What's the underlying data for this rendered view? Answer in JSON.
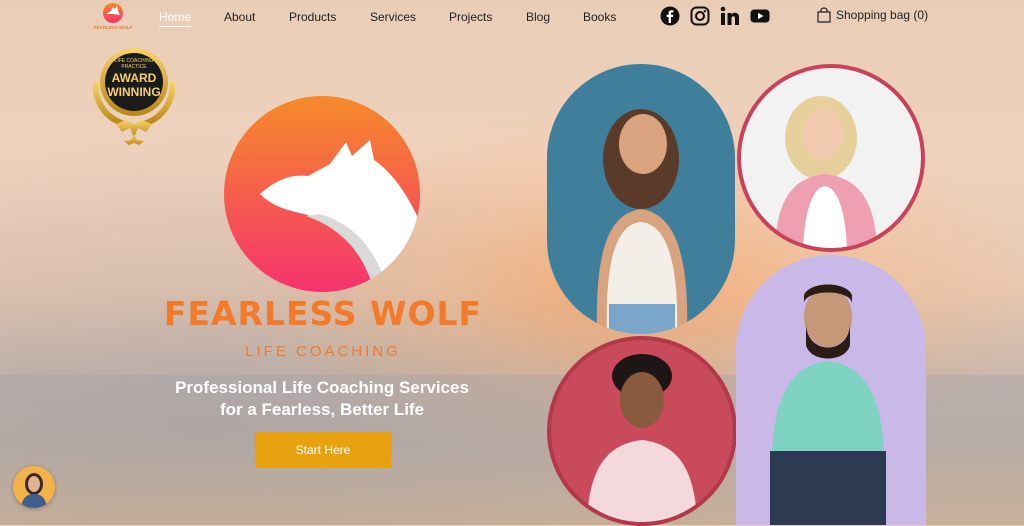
{
  "header": {
    "logo_text": "FEARLESS WOLF",
    "nav": [
      {
        "label": "Home",
        "active": true
      },
      {
        "label": "About"
      },
      {
        "label": "Products"
      },
      {
        "label": "Services"
      },
      {
        "label": "Projects"
      },
      {
        "label": "Blog"
      },
      {
        "label": "Books"
      }
    ],
    "social_icons": [
      "facebook-icon",
      "instagram-icon",
      "linkedin-icon",
      "youtube-icon"
    ],
    "cart_label": "Shopping bag (0)"
  },
  "award": {
    "top_text": "LIFE COACHING PRACTICE",
    "main_line1": "AWARD",
    "main_line2": "WINNING"
  },
  "hero": {
    "brand_name": "FEARLESS WOLF",
    "brand_sub": "LIFE COACHING",
    "tagline_line1": "Professional Life Coaching Services",
    "tagline_line2": "for a Fearless, Better Life",
    "cta_label": "Start Here"
  },
  "colors": {
    "brand_orange": "#f27a28",
    "cta": "#e8a10f",
    "gradient_top": "#f58a2a",
    "gradient_bottom": "#f5336e"
  }
}
